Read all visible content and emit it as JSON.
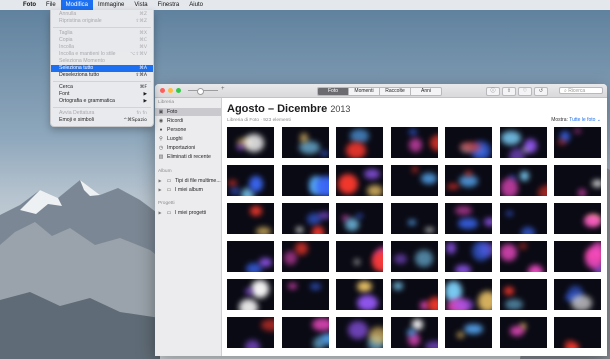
{
  "menubar": {
    "app": "Foto",
    "items": [
      "File",
      "Modifica",
      "Immagine",
      "Vista",
      "Finestra",
      "Aiuto"
    ],
    "active": "Modifica"
  },
  "edit_menu": {
    "rows": [
      {
        "label": "Annulla",
        "shortcut": "⌘Z",
        "enabled": false
      },
      {
        "label": "Ripristina originale",
        "shortcut": "⇧⌘Z",
        "enabled": false
      },
      {
        "separator": true
      },
      {
        "label": "Taglia",
        "shortcut": "⌘X",
        "enabled": false
      },
      {
        "label": "Copia",
        "shortcut": "⌘C",
        "enabled": false
      },
      {
        "label": "Incolla",
        "shortcut": "⌘V",
        "enabled": false
      },
      {
        "label": "Incolla e mantieni lo stile",
        "shortcut": "⌥⇧⌘V",
        "enabled": false
      },
      {
        "label": "Seleziona Momento",
        "shortcut": "",
        "enabled": false
      },
      {
        "label": "Seleziona tutto",
        "shortcut": "⌘A",
        "enabled": true,
        "highlighted": true
      },
      {
        "label": "Deseleziona tutto",
        "shortcut": "⇧⌘A",
        "enabled": true
      },
      {
        "separator": true
      },
      {
        "label": "Cerca",
        "shortcut": "⌘F",
        "enabled": true
      },
      {
        "label": "Font",
        "shortcut": "▶",
        "enabled": true
      },
      {
        "label": "Ortografia e grammatica",
        "shortcut": "▶",
        "enabled": true
      },
      {
        "separator": true
      },
      {
        "label": "Avvia Dettatura",
        "shortcut": "fn fn",
        "enabled": false
      },
      {
        "label": "Emoji e simboli",
        "shortcut": "^⌘Spazio",
        "enabled": true
      }
    ]
  },
  "toolbar": {
    "tabs": [
      "Foto",
      "Momenti",
      "Raccolte",
      "Anni"
    ],
    "selected_tab": "Foto",
    "search_placeholder": "Ricerca",
    "zoom_plus": "+"
  },
  "sidebar": {
    "sections": [
      {
        "header": "Libreria",
        "items": [
          {
            "label": "Foto",
            "icon": "photos-icon",
            "selected": true
          },
          {
            "label": "Ricordi",
            "icon": "memories-icon"
          },
          {
            "label": "Persone",
            "icon": "people-icon"
          },
          {
            "label": "Luoghi",
            "icon": "places-icon"
          },
          {
            "label": "Importazioni",
            "icon": "imports-icon"
          },
          {
            "label": "Eliminati di recente",
            "icon": "trash-icon"
          }
        ]
      },
      {
        "header": "Album",
        "items": [
          {
            "label": "Tipi di file multime...",
            "icon": "folder-icon",
            "disclosure": true
          },
          {
            "label": "I miei album",
            "icon": "folder-icon",
            "disclosure": true
          }
        ]
      },
      {
        "header": "Progetti",
        "items": [
          {
            "label": "I miei progetti",
            "icon": "folder-icon",
            "disclosure": true
          }
        ]
      }
    ]
  },
  "main": {
    "title": "Agosto – Dicembre",
    "year": "2013",
    "subtitle": "Libreria di Foto · 923 elementi",
    "showing_label": "Mostra:",
    "showing_value": "Tutte le foto ⌄"
  },
  "colors": {
    "accent": "#1c6ff0",
    "thumb_glows": [
      "#3d6cff",
      "#9b5cff",
      "#ff4fd0",
      "#ff3a2e",
      "#ffd36e",
      "#7fd4ff",
      "#ffffff",
      "#5ab0ff"
    ]
  }
}
